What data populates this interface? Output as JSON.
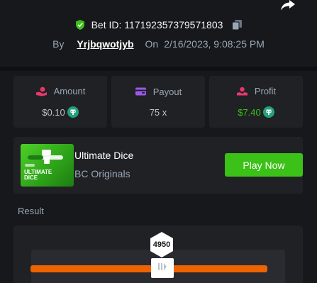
{
  "header": {
    "bet_id_label": "Bet ID: 117192357379571803",
    "by_label": "By",
    "username": "Yrjbqwotjyb",
    "on_label": "On",
    "datetime": "2/16/2023, 9:08:25 PM"
  },
  "stats": [
    {
      "label": "Amount",
      "value": "$0.10",
      "icon": "hand-coins-icon",
      "accent": "#e8386a"
    },
    {
      "label": "Payout",
      "value": "75 x",
      "icon": "wallet-icon",
      "accent": "#9b59e8"
    },
    {
      "label": "Profit",
      "value": "$7.40",
      "icon": "profit-hand-icon",
      "accent": "#e8386a"
    }
  ],
  "game": {
    "title": "Ultimate Dice",
    "provider": "BC Originals",
    "thumb_text": "ULTIMATE DICE",
    "play_label": "Play Now"
  },
  "result": {
    "label": "Result",
    "value": "4950"
  },
  "colors": {
    "green": "#3bc117",
    "orange": "#ed6300",
    "tether": "#26a17b"
  }
}
